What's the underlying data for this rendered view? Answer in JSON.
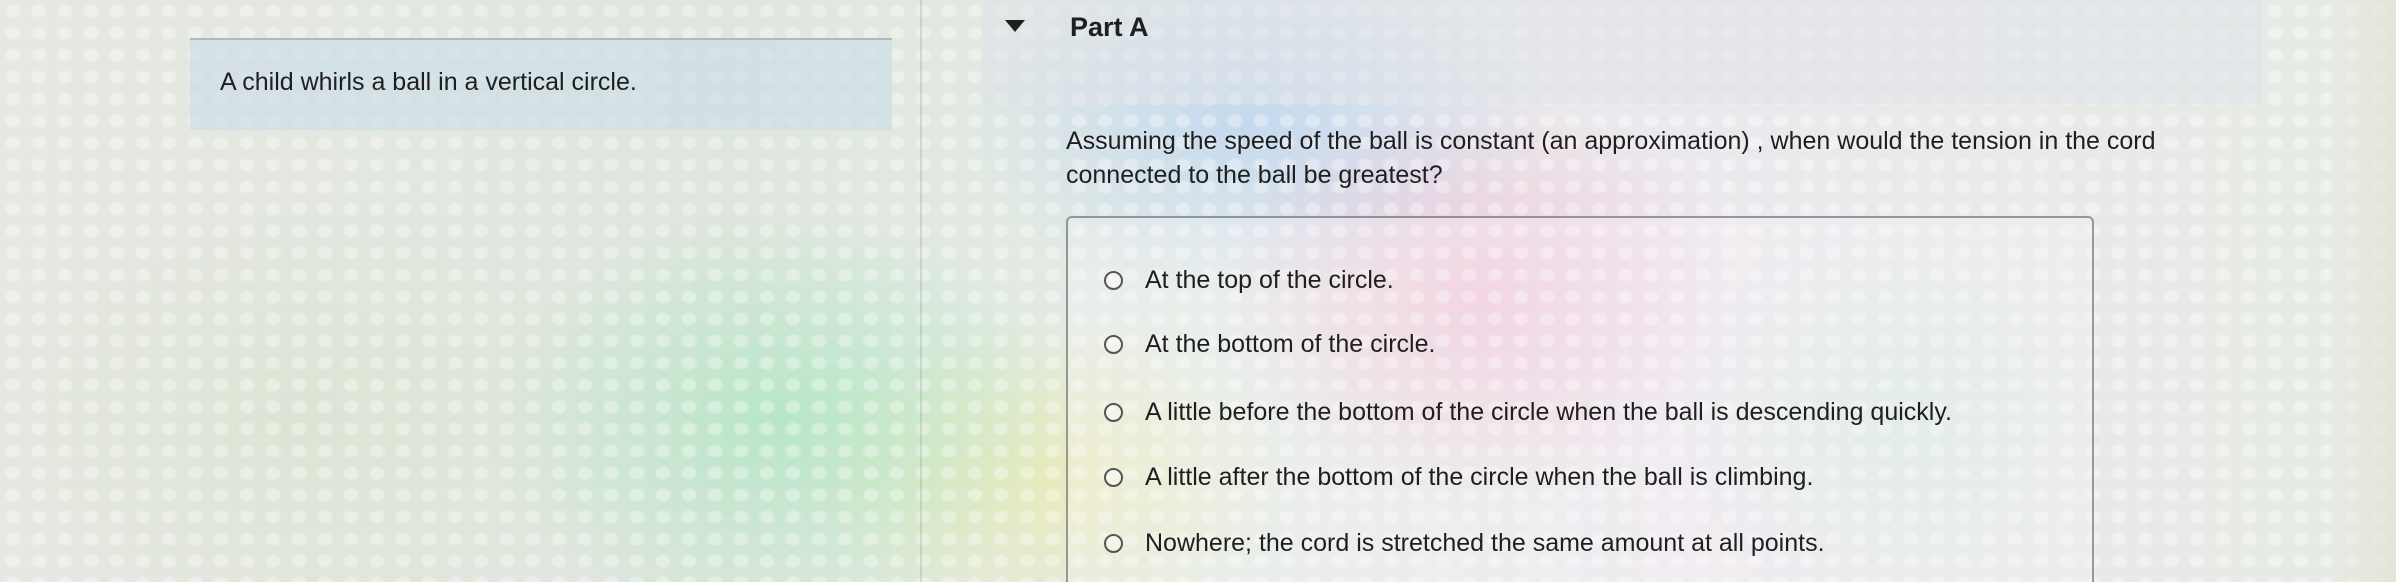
{
  "context": {
    "statement": "A child whirls a ball in a vertical circle."
  },
  "part": {
    "title": "Part A",
    "question": "Assuming the speed of the ball is constant (an approximation) , when would the tension in the cord connected to the ball be greatest?"
  },
  "options": [
    {
      "label": "At the top of the circle.",
      "selected": false
    },
    {
      "label": "At the bottom of the circle.",
      "selected": false
    },
    {
      "label": "A little before the bottom of the circle when the ball is descending quickly.",
      "selected": false
    },
    {
      "label": "A little after the bottom of the circle when the ball is climbing.",
      "selected": false
    },
    {
      "label": "Nowhere; the cord is stretched the same amount at all points.",
      "selected": false
    }
  ],
  "icons": {
    "collapse": "caret-down-icon",
    "radio": "radio-unselected-icon"
  }
}
